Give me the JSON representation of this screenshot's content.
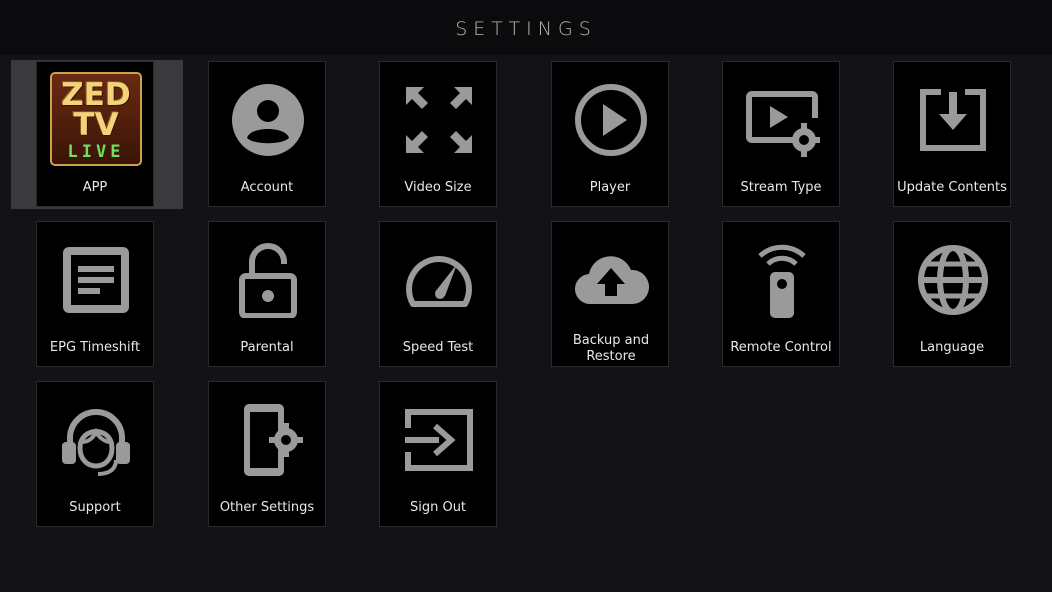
{
  "header": {
    "title": "SETTINGS"
  },
  "logo": {
    "line1": "ZED",
    "line2": "TV",
    "line3": "LIVE"
  },
  "tiles": [
    {
      "label": "APP",
      "icon": "zed-tv-live-logo",
      "focused": true
    },
    {
      "label": "Account",
      "icon": "account-icon"
    },
    {
      "label": "Video Size",
      "icon": "video-size-icon"
    },
    {
      "label": "Player",
      "icon": "play-icon"
    },
    {
      "label": "Stream Type",
      "icon": "stream-type-icon"
    },
    {
      "label": "Update Contents",
      "icon": "update-download-icon"
    },
    {
      "label": "EPG Timeshift",
      "icon": "epg-icon"
    },
    {
      "label": "Parental",
      "icon": "unlock-icon"
    },
    {
      "label": "Speed Test",
      "icon": "speedometer-icon"
    },
    {
      "label": "Backup and Restore",
      "icon": "cloud-upload-icon"
    },
    {
      "label": "Remote Control",
      "icon": "remote-control-icon"
    },
    {
      "label": "Language",
      "icon": "globe-icon"
    },
    {
      "label": "Support",
      "icon": "support-headset-icon"
    },
    {
      "label": "Other Settings",
      "icon": "phone-settings-icon"
    },
    {
      "label": "Sign Out",
      "icon": "sign-out-icon"
    }
  ],
  "colors": {
    "icon": "#9a9a9a",
    "tile_bg": "#000000",
    "focus_bg": "#3a3a3d",
    "page_bg": "#131317"
  }
}
